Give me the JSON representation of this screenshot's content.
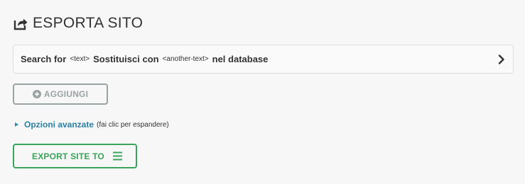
{
  "header": {
    "title": "ESPORTA SITO",
    "icon": "share-export-icon"
  },
  "search_replace": {
    "search_label": "Search for",
    "search_placeholder": "<text>",
    "replace_label": "Sostituisci con",
    "replace_placeholder": "<another-text>",
    "suffix_label": "nel database",
    "expand_icon": "chevron-right-icon"
  },
  "add_button": {
    "label": "AGGIUNGI",
    "icon": "plus-circle-icon"
  },
  "advanced_options": {
    "link_label": "Opzioni avanzate",
    "hint": "(fai clic per espandere)"
  },
  "export_button": {
    "label": "EXPORT SITE TO",
    "icon": "hamburger-menu-icon"
  },
  "colors": {
    "accent_green": "#3aa45a",
    "link_blue": "#2a7fa6",
    "disabled_gray": "#9aa3a3",
    "background": "#f7f7f7"
  }
}
